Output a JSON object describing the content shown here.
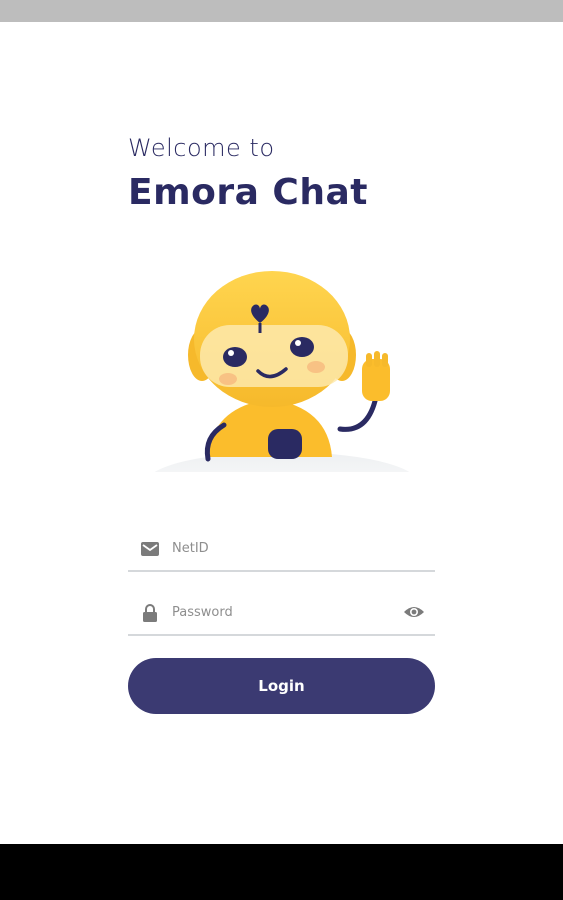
{
  "header": {
    "welcome_text": "Welcome to",
    "app_name": "Emora Chat"
  },
  "form": {
    "netid": {
      "placeholder": "NetID",
      "value": "",
      "icon": "email-icon"
    },
    "password": {
      "placeholder": "Password",
      "value": "",
      "icon": "lock-icon",
      "toggle_icon": "eye-icon"
    },
    "login_label": "Login"
  },
  "colors": {
    "brand": "#2a2a62",
    "button": "#3b3a72",
    "robot_yellow": "#fbc02d"
  }
}
